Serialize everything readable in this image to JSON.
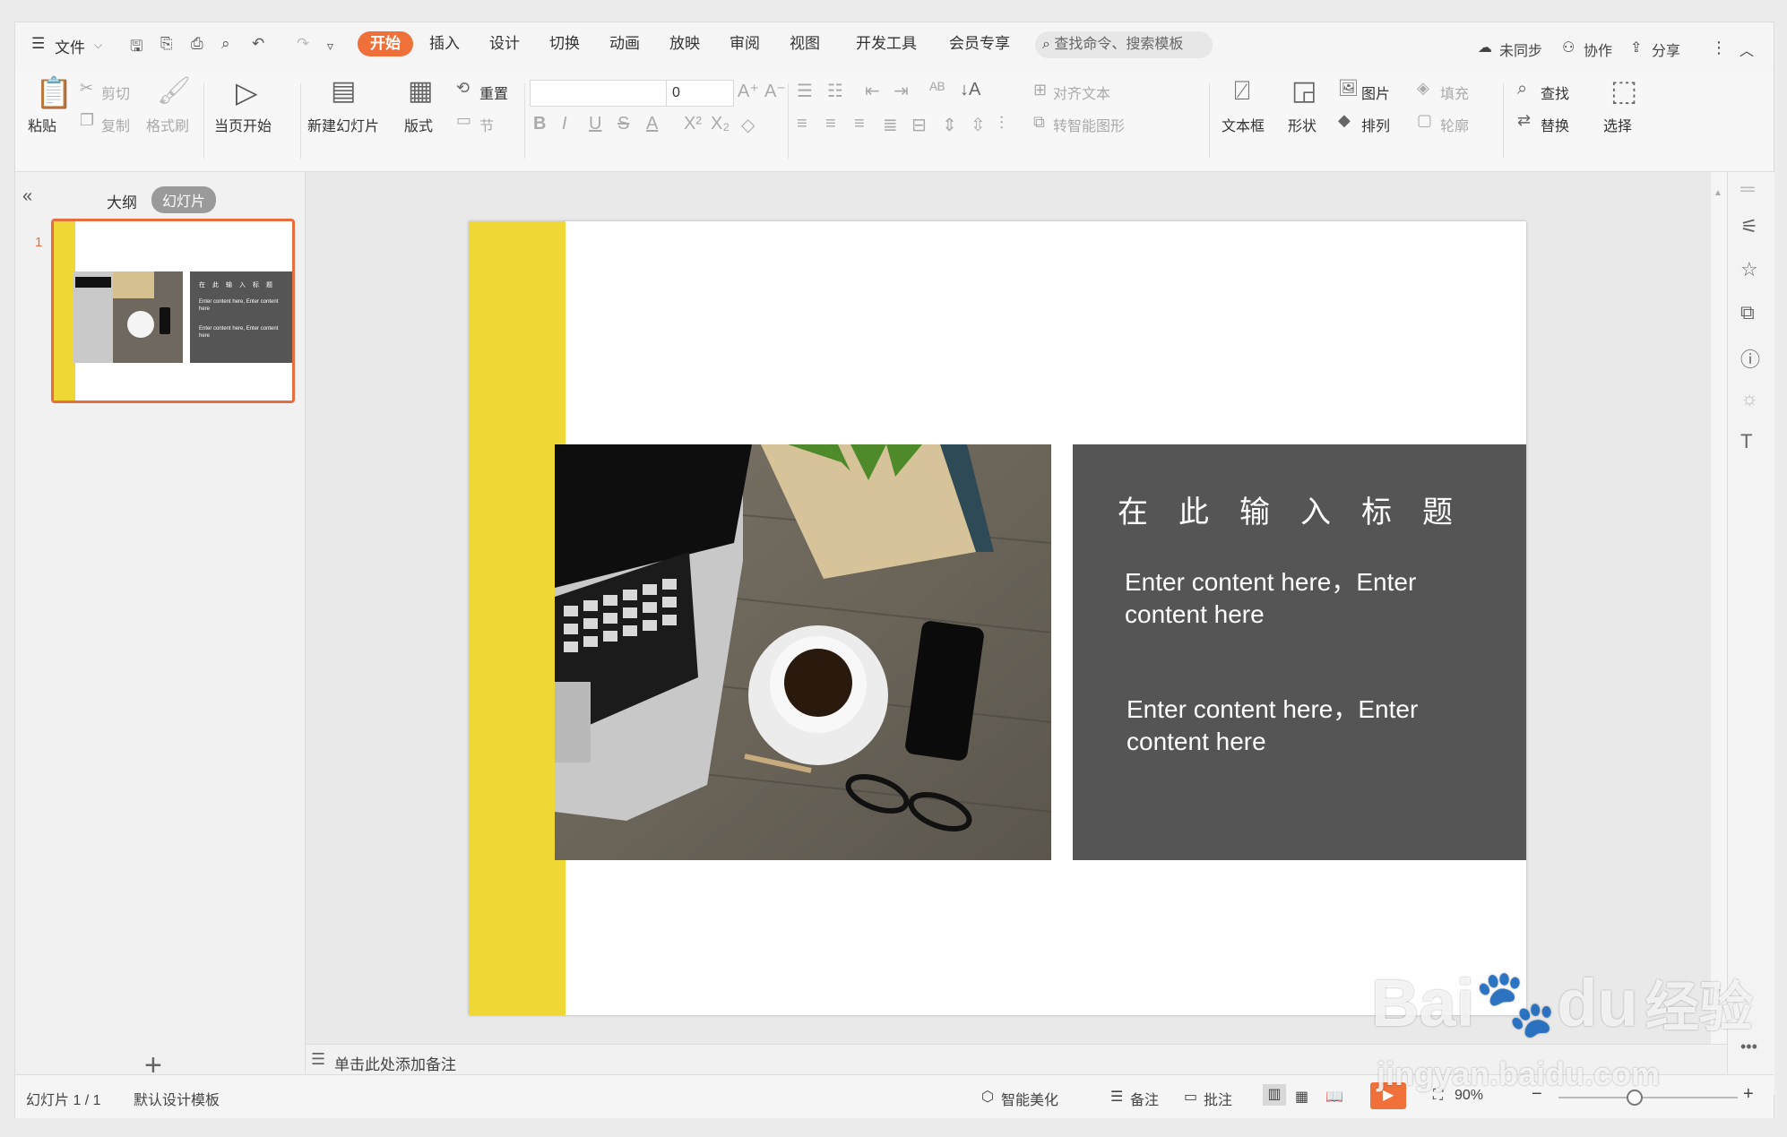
{
  "menubar": {
    "file_label": "文件",
    "tabs": [
      "开始",
      "插入",
      "设计",
      "切换",
      "动画",
      "放映",
      "审阅",
      "视图",
      "开发工具",
      "会员专享"
    ],
    "search_placeholder": "查找命令、搜索模板",
    "sync_label": "未同步",
    "collab_label": "协作",
    "share_label": "分享"
  },
  "toolbar": {
    "paste": "粘贴",
    "cut": "剪切",
    "copy": "复制",
    "format_painter": "格式刷",
    "play_current": "当页开始",
    "new_slide": "新建幻灯片",
    "layout": "版式",
    "reset": "重置",
    "section": "节",
    "font_size": "0",
    "align_text": "对齐文本",
    "smart_art": "转智能图形",
    "textbox": "文本框",
    "shape": "形状",
    "picture": "图片",
    "fill": "填充",
    "arrange": "排列",
    "outline": "轮廓",
    "find": "查找",
    "replace": "替换",
    "select": "选择"
  },
  "left_panel": {
    "outline_tab": "大纲",
    "slides_tab": "幻灯片",
    "slide_number": "1",
    "thumb_title": "在此输入标题",
    "thumb_line1": "Enter content here,  Enter content here",
    "thumb_line2": "Enter content here,  Enter content here"
  },
  "slide": {
    "title": "在此输入标题",
    "text1": "Enter content here，Enter content here",
    "text2": "Enter content here，Enter content here",
    "accent_color": "#efd836",
    "panel_color": "#555555"
  },
  "notes": {
    "placeholder": "单击此处添加备注"
  },
  "statusbar": {
    "slide_info": "幻灯片 1 / 1",
    "template": "默认设计模板",
    "beautify": "智能美化",
    "notes": "备注",
    "comments": "批注",
    "zoom": "90%"
  },
  "watermark": {
    "brand": "Bai",
    "brand2": "du",
    "suffix": "经验",
    "url": "jingyan.baidu.com"
  }
}
